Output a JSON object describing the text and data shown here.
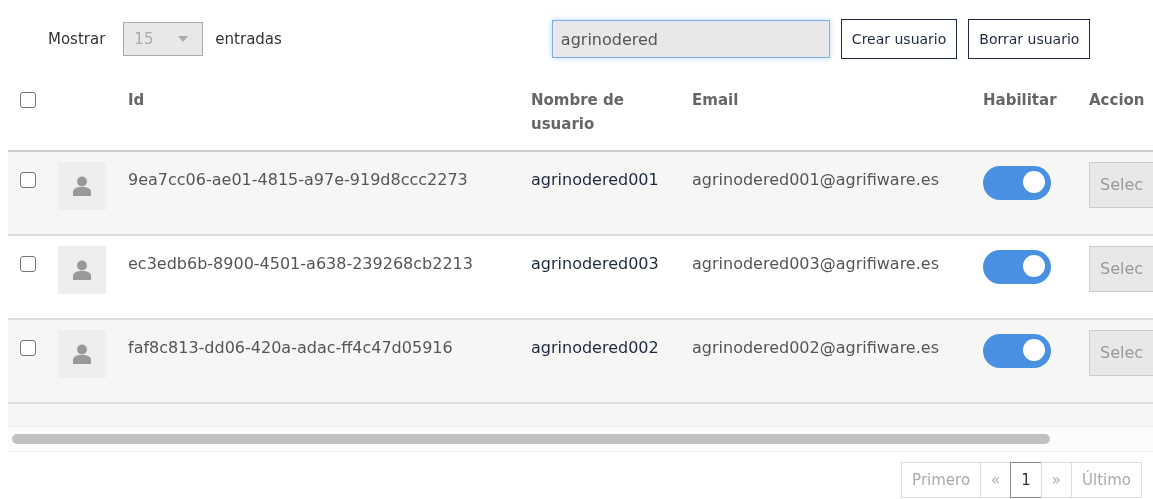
{
  "length_control": {
    "label_before": "Mostrar",
    "value": "15",
    "disabled": true,
    "label_after": "entradas"
  },
  "search": {
    "value": "agrinodered",
    "focused": true
  },
  "buttons": [
    "Crear usuario",
    "Borrar usuario"
  ],
  "table": {
    "select_all": {
      "checked": false
    },
    "columns": [
      "Id",
      "Nombre de usuario",
      "Email",
      "Habilitar",
      "Accion"
    ],
    "rows": [
      {
        "checked": false,
        "id": "9ea7cc06-ae01-4815-a97e-919d8ccc2273",
        "username": "agrinodered001",
        "email": "agrinodered001@agrifiware.es",
        "enabled": true,
        "action": "Selec"
      },
      {
        "checked": false,
        "id": "ec3edb6b-8900-4501-a638-239268cb2213",
        "username": "agrinodered003",
        "email": "agrinodered003@agrifiware.es",
        "enabled": true,
        "action": "Selec"
      },
      {
        "checked": false,
        "id": "faf8c813-dd06-420a-adac-ff4c47d05916",
        "username": "agrinodered002",
        "email": "agrinodered002@agrifiware.es",
        "enabled": true,
        "action": "Selec"
      }
    ]
  },
  "pagination": [
    {
      "label": "Primero",
      "selected": false,
      "disabled": true
    },
    {
      "label": "«",
      "selected": false,
      "disabled": true
    },
    {
      "label": "1",
      "selected": true,
      "disabled": false
    },
    {
      "label": "»",
      "selected": false,
      "disabled": true
    },
    {
      "label": "Último",
      "selected": false,
      "disabled": true
    }
  ]
}
